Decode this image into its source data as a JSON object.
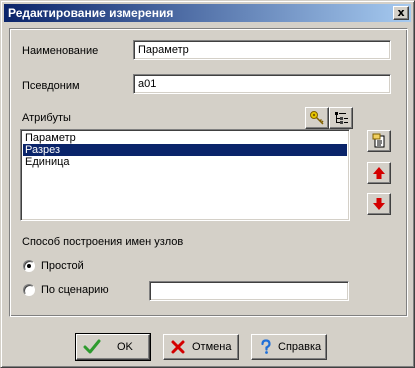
{
  "window": {
    "title": "Редактирование измерения",
    "close_glyph": "x"
  },
  "fields": {
    "name_label": "Наименование",
    "name_value": "Параметр",
    "alias_label": "Псевдоним",
    "alias_value": "a01"
  },
  "attributes": {
    "label": "Атрибуты",
    "items": [
      "Параметр",
      "Разрез",
      "Единица"
    ],
    "selected_index": 1
  },
  "toolbar_icons": {
    "key": "key-icon",
    "tree": "tree-list-icon",
    "edit": "edit-icon",
    "up": "arrow-up-icon",
    "down": "arrow-down-icon"
  },
  "build_method": {
    "label": "Способ построения имен узлов",
    "option_simple": "Простой",
    "option_script": "По сценарию",
    "selected": "simple",
    "script_value": ""
  },
  "buttons": {
    "ok": "OK",
    "cancel": "Отмена",
    "help": "Справка"
  },
  "colors": {
    "titlebar_start": "#0a246a",
    "titlebar_end": "#a6caf0",
    "selection": "#0a246a",
    "ok_green": "#2e9b2e",
    "cancel_red": "#d40000",
    "help_blue": "#1e6fd9"
  }
}
